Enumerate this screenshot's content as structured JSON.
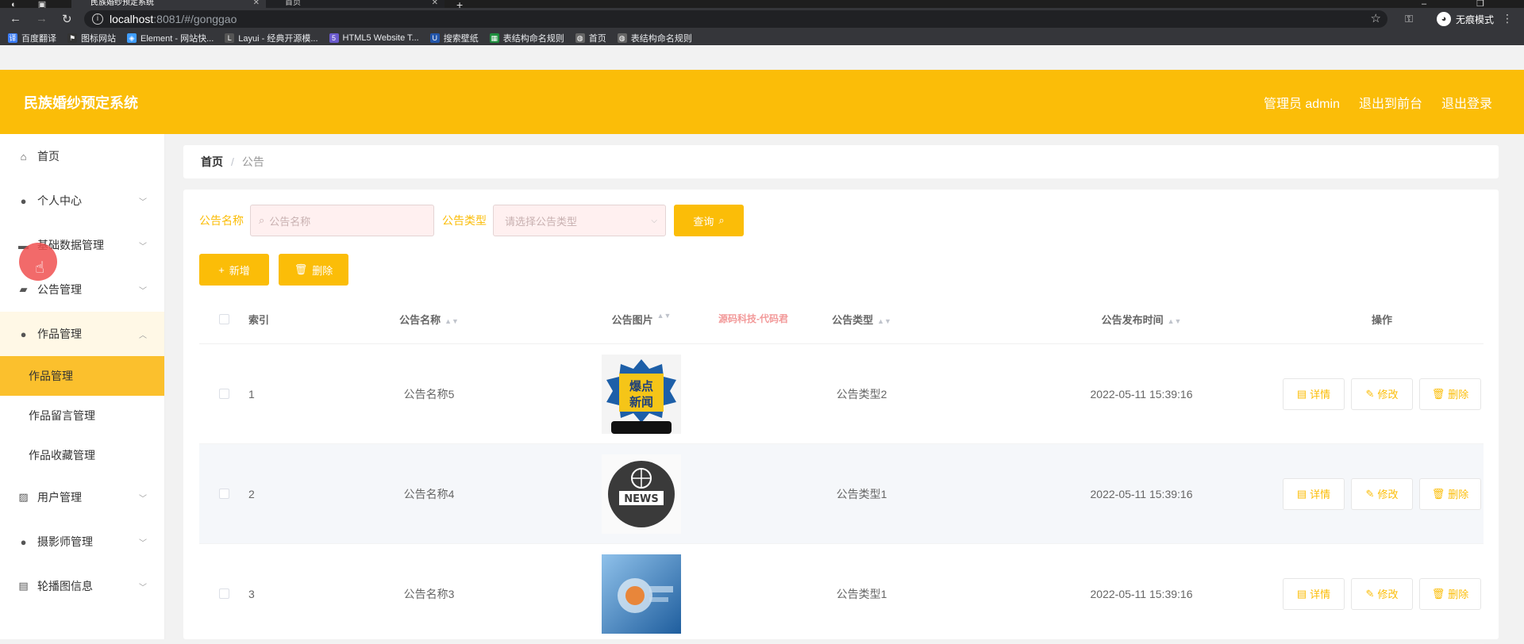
{
  "browser": {
    "tabs": [
      {
        "title": "民族婚纱预定系统",
        "active": true
      },
      {
        "title": "首页",
        "active": false
      }
    ],
    "url_host": "localhost",
    "url_path": ":8081/#/gonggao",
    "incognito_label": "无痕模式",
    "bookmarks": [
      {
        "label": "百度翻译",
        "icon": "translate-icon",
        "color": "#3b7cf5"
      },
      {
        "label": "图标网站",
        "icon": "flag-icon",
        "color": "#333333"
      },
      {
        "label": "Element - 网站快...",
        "icon": "element-icon",
        "color": "#409eff"
      },
      {
        "label": "Layui - 经典开源模...",
        "icon": "layui-icon",
        "color": "#555555"
      },
      {
        "label": "HTML5 Website T...",
        "icon": "html5-icon",
        "color": "#6a5acd"
      },
      {
        "label": "搜索壁纸",
        "icon": "wallpaper-icon",
        "color": "#2255aa"
      },
      {
        "label": "表结构命名规则",
        "icon": "sheet-icon",
        "color": "#1e8e3e"
      },
      {
        "label": "首页",
        "icon": "globe-icon",
        "color": "#666666"
      },
      {
        "label": "表结构命名规则",
        "icon": "globe-icon",
        "color": "#666666"
      }
    ]
  },
  "header": {
    "title": "民族婚纱预定系统",
    "admin": "管理员 admin",
    "to_front": "退出到前台",
    "logout": "退出登录"
  },
  "sidebar": {
    "items": [
      {
        "label": "首页",
        "icon": "home-icon",
        "has_chevron": false
      },
      {
        "label": "个人中心",
        "icon": "user-icon",
        "has_chevron": true
      },
      {
        "label": "基础数据管理",
        "icon": "data-icon",
        "has_chevron": true
      },
      {
        "label": "公告管理",
        "icon": "notice-icon",
        "has_chevron": true
      },
      {
        "label": "作品管理",
        "icon": "user-icon",
        "has_chevron": true,
        "open": true,
        "children": [
          "作品管理",
          "作品留言管理",
          "作品收藏管理"
        ]
      },
      {
        "label": "用户管理",
        "icon": "chart-icon",
        "has_chevron": true
      },
      {
        "label": "摄影师管理",
        "icon": "location-icon",
        "has_chevron": true
      },
      {
        "label": "轮播图信息",
        "icon": "clipboard-icon",
        "has_chevron": true
      }
    ],
    "active_child": "作品管理"
  },
  "breadcrumb": {
    "home": "首页",
    "current": "公告"
  },
  "filters": {
    "name_label": "公告名称",
    "name_placeholder": "公告名称",
    "type_label": "公告类型",
    "type_placeholder": "请选择公告类型",
    "query_button": "查询"
  },
  "actions": {
    "add": "新增",
    "delete": "删除"
  },
  "table": {
    "headers": {
      "index": "索引",
      "name": "公告名称",
      "image": "公告图片",
      "type": "公告类型",
      "time": "公告发布时间",
      "ops": "操作"
    },
    "rows": [
      {
        "index": "1",
        "name": "公告名称5",
        "type": "公告类型2",
        "time": "2022-05-11 15:39:16",
        "thumb": "news-burst"
      },
      {
        "index": "2",
        "name": "公告名称4",
        "type": "公告类型1",
        "time": "2022-05-11 15:39:16",
        "thumb": "news-globe"
      },
      {
        "index": "3",
        "name": "公告名称3",
        "type": "公告类型1",
        "time": "2022-05-11 15:39:16",
        "thumb": "news-blue"
      }
    ],
    "op_labels": {
      "detail": "详情",
      "edit": "修改",
      "delete": "删除"
    }
  },
  "thumb_text": {
    "burst_line1": "爆点",
    "burst_line2": "新闻",
    "globe": "NEWS"
  },
  "watermark": "源码科技-代码君",
  "colors": {
    "primary": "#fbbd08",
    "active_menu": "#fbc02d"
  }
}
